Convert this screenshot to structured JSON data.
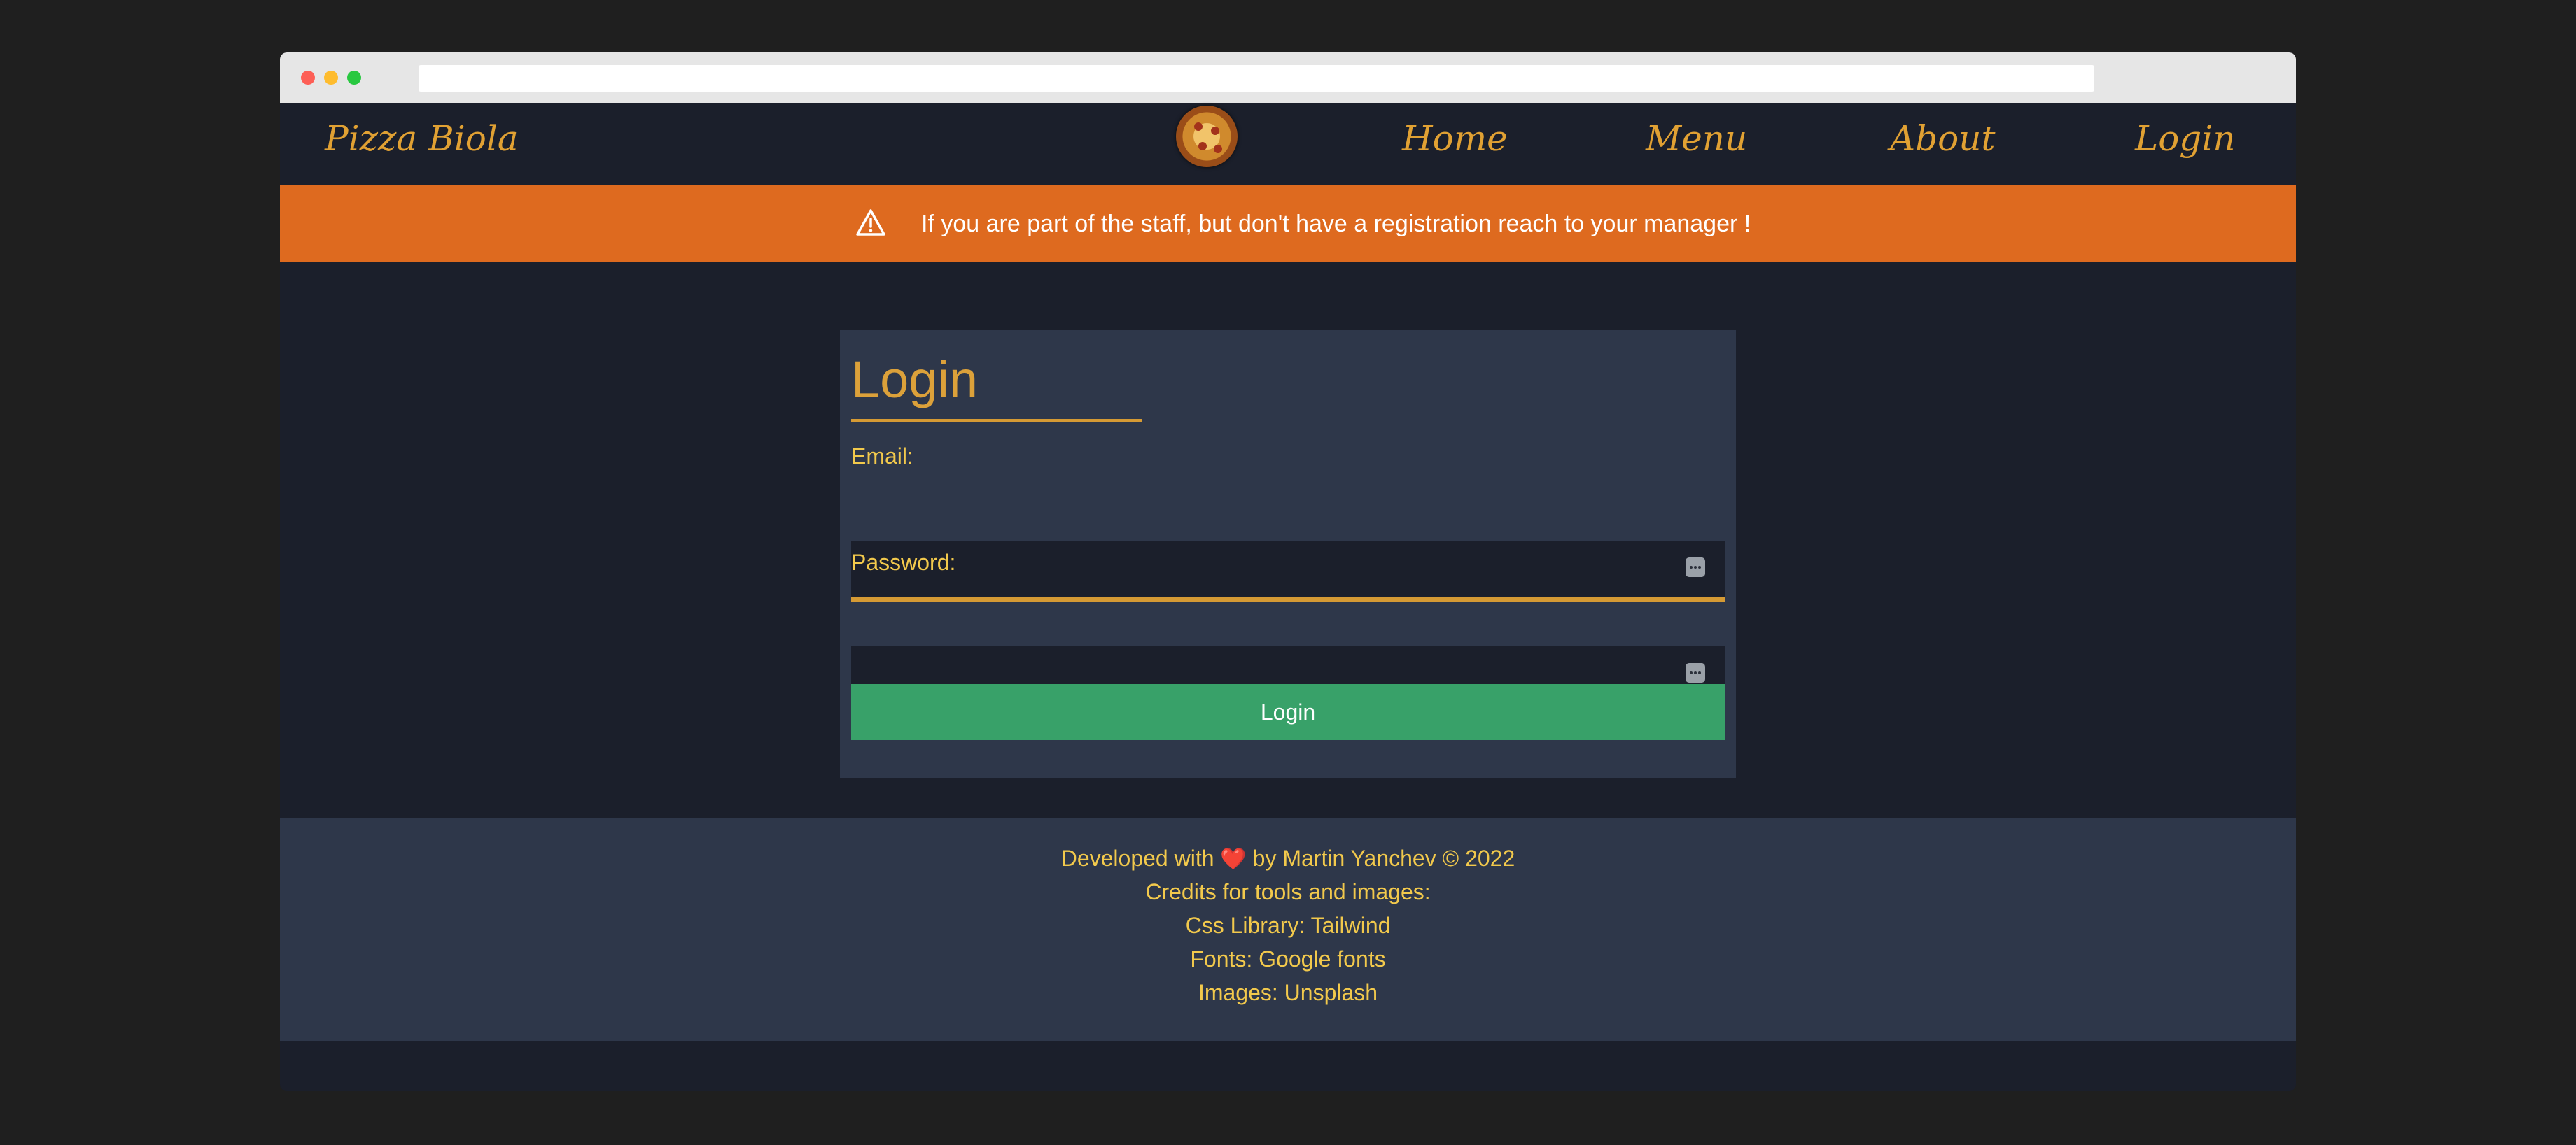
{
  "nav": {
    "brand": "Pizza Biola",
    "links": [
      "Home",
      "Menu",
      "About",
      "Login"
    ]
  },
  "alert": {
    "icon": "warning-triangle-icon",
    "text": "If you are part of the staff, but don't have a registration reach to your manager !"
  },
  "login_form": {
    "title": "Login",
    "email_label": "Email:",
    "email_value": "",
    "password_label": "Password:",
    "password_value": "",
    "field_icon": "password-manager-key-icon",
    "submit_label": "Login"
  },
  "footer": {
    "developed_prefix": "Developed with",
    "heart": "❤️",
    "developed_suffix": "by Martin Yanchev © 2022",
    "credits": "Credits for tools and images:",
    "css_library": "Css Library: Tailwind",
    "fonts": "Fonts: Google fonts",
    "images": "Images: Unsplash"
  },
  "colors": {
    "page_bg": "#1b1f2b",
    "accent_gold": "#d59a34",
    "alert_orange": "#de6a1f",
    "card_bg": "#2e374a",
    "button_green": "#38a169",
    "footer_text": "#f2c94c"
  }
}
